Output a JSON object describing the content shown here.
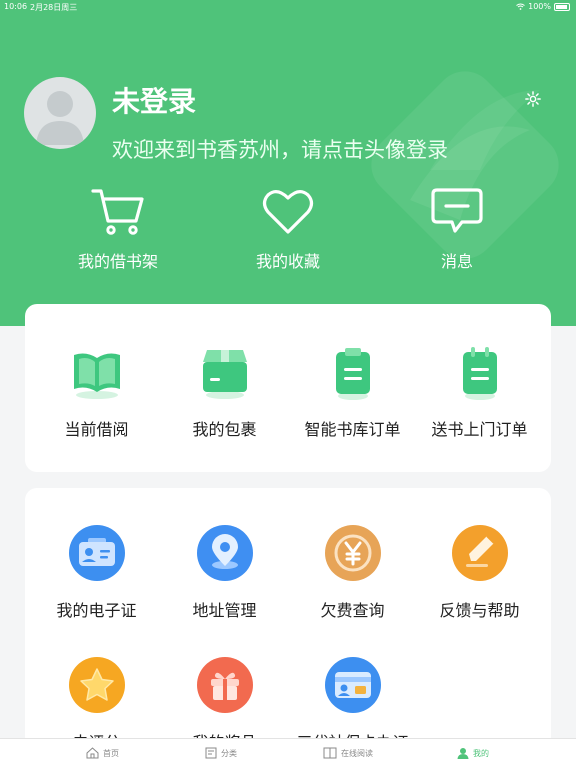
{
  "status_bar": {
    "time": "10:06",
    "date": "2月28日周三",
    "battery": "100%"
  },
  "profile": {
    "name": "未登录",
    "welcome": "欢迎来到书香苏州，请点击头像登录"
  },
  "quick_actions": [
    {
      "label": "我的借书架",
      "icon": "cart-icon"
    },
    {
      "label": "我的收藏",
      "icon": "heart-icon"
    },
    {
      "label": "消息",
      "icon": "message-icon"
    }
  ],
  "orders": [
    {
      "label": "当前借阅",
      "icon": "open-book-icon"
    },
    {
      "label": "我的包裹",
      "icon": "package-icon"
    },
    {
      "label": "智能书库订单",
      "icon": "clipboard-icon"
    },
    {
      "label": "送书上门订单",
      "icon": "clipboard-icon"
    }
  ],
  "services": [
    {
      "label": "我的电子证",
      "icon": "id-card-icon",
      "color": "#3d8ff0"
    },
    {
      "label": "地址管理",
      "icon": "location-pin-icon",
      "color": "#3f8ff2"
    },
    {
      "label": "欠费查询",
      "icon": "yen-coin-icon",
      "color": "#e7a457"
    },
    {
      "label": "反馈与帮助",
      "icon": "pencil-icon",
      "color": "#f3a02c"
    },
    {
      "label": "去评分",
      "icon": "star-icon",
      "color": "#f6a722"
    },
    {
      "label": "我的奖品",
      "icon": "gift-icon",
      "color": "#f26a4f"
    },
    {
      "label": "三代社保卡办证",
      "icon": "social-security-card-icon",
      "color": "#3d8ff0"
    }
  ],
  "tabs": [
    {
      "label": "首页",
      "icon": "home-icon"
    },
    {
      "label": "分类",
      "icon": "category-icon"
    },
    {
      "label": "在线阅读",
      "icon": "book-icon"
    },
    {
      "label": "我的",
      "icon": "user-icon"
    }
  ],
  "colors": {
    "primary": "#4fc37a",
    "background": "#f4f5f6"
  }
}
